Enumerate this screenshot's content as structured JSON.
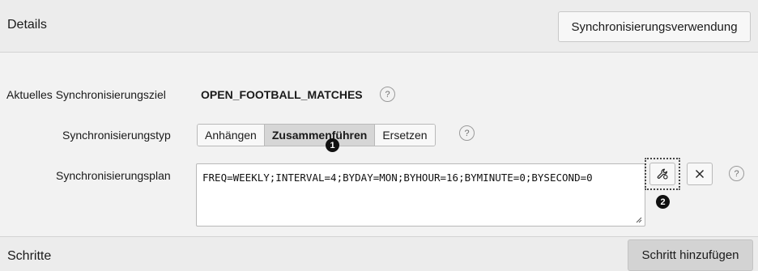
{
  "details_region": {
    "title": "Details",
    "usage_button_label": "Synchronisierungsverwendung"
  },
  "target": {
    "label": "Aktuelles Synchronisierungsziel",
    "value": "OPEN_FOOTBALL_MATCHES",
    "help": "?"
  },
  "sync_type": {
    "label": "Synchronisierungstyp",
    "options": [
      "Anhängen",
      "Zusammenführen",
      "Ersetzen"
    ],
    "selected": "Zusammenführen",
    "help": "?"
  },
  "sync_plan": {
    "label": "Synchronisierungsplan",
    "value": "FREQ=WEEKLY;INTERVAL=4;BYDAY=MON;BYHOUR=16;BYMINUTE=0;BYSECOND=0",
    "help": "?",
    "builder_icon": "wrench-icon",
    "clear_icon": "close-icon"
  },
  "callouts": [
    "1",
    "2"
  ],
  "steps_region": {
    "title": "Schritte",
    "add_button_label": "Schritt hinzufügen"
  },
  "colors": {
    "background": "#f2f2f2",
    "header": "#ececec",
    "active_segment": "#d6d6d6",
    "badge": "#111111"
  }
}
